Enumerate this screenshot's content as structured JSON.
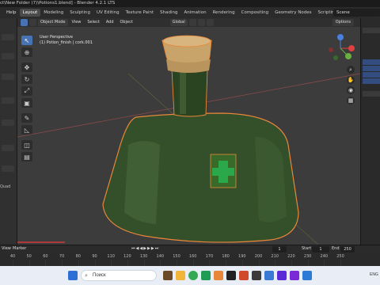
{
  "window": {
    "title": "ct\\New Folder (7)\\Potions1.blend] - Blender 4.2.1 LTS"
  },
  "topbar": {
    "help_label": "Help",
    "workspaces": [
      "Layout",
      "Modeling",
      "Sculpting",
      "UV Editing",
      "Texture Paint",
      "Shading",
      "Animation",
      "Rendering",
      "Compositing",
      "Geometry Nodes",
      "Scripting"
    ],
    "active_workspace": "Layout",
    "add_workspace": "+",
    "scene_label": "Scene"
  },
  "viewport": {
    "mode": "Object Mode",
    "menus": [
      "View",
      "Select",
      "Add",
      "Object"
    ],
    "transform_orientation": "Global",
    "options_label": "Options",
    "perspective_label": "User Perspective",
    "object_label": "(1) Potion_finish | cork.001",
    "gizmo_axes": {
      "x": "X",
      "y": "Y",
      "z": "Z"
    }
  },
  "left_panel": {
    "quad_label": "Quad"
  },
  "timeline": {
    "view_label": "View",
    "marker_label": "Marker",
    "current_frame": "1",
    "start_label": "Start",
    "start_value": "1",
    "end_label": "End",
    "end_value": "250",
    "ticks": [
      "40",
      "50",
      "60",
      "70",
      "80",
      "90",
      "110",
      "120",
      "130",
      "140",
      "150",
      "160",
      "170",
      "180",
      "190",
      "200",
      "210",
      "220",
      "230",
      "240",
      "250"
    ]
  },
  "taskbar": {
    "search_placeholder": "Поиск",
    "lang": "ENG"
  },
  "colors": {
    "accent": "#4772b3",
    "viewport_bg": "#3c3c3c",
    "selection_outline": "#e8873a",
    "bottle_green": "#2e4a22",
    "cork": "#c8a36a",
    "cross_green": "#2aa84a"
  }
}
